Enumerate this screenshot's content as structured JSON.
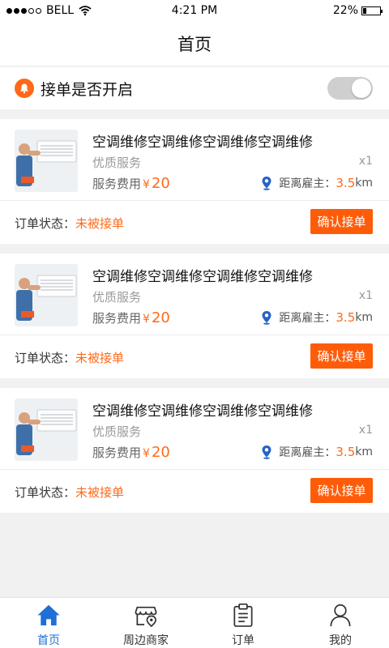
{
  "status_bar": {
    "carrier": "BELL",
    "time": "4:21 PM",
    "battery": "22%",
    "battery_level": 0.22
  },
  "nav": {
    "title": "首页"
  },
  "accept_toggle": {
    "label": "接单是否开启",
    "enabled": false
  },
  "orders": [
    {
      "title": "空调维修空调维修空调维修空调维修",
      "subtitle": "优质服务",
      "quantity": "x1",
      "fee_label": "服务费用",
      "currency": "¥",
      "fee": "20",
      "distance_label": "距离雇主：",
      "distance_value": "3.5",
      "distance_unit": "km",
      "status_label": "订单状态：",
      "status": "未被接单",
      "action": "确认接单"
    },
    {
      "title": "空调维修空调维修空调维修空调维修",
      "subtitle": "优质服务",
      "quantity": "x1",
      "fee_label": "服务费用",
      "currency": "¥",
      "fee": "20",
      "distance_label": "距离雇主：",
      "distance_value": "3.5",
      "distance_unit": "km",
      "status_label": "订单状态：",
      "status": "未被接单",
      "action": "确认接单"
    },
    {
      "title": "空调维修空调维修空调维修空调维修",
      "subtitle": "优质服务",
      "quantity": "x1",
      "fee_label": "服务费用",
      "currency": "¥",
      "fee": "20",
      "distance_label": "距离雇主：",
      "distance_value": "3.5",
      "distance_unit": "km",
      "status_label": "订单状态：",
      "status": "未被接单",
      "action": "确认接单"
    }
  ],
  "tabs": [
    {
      "label": "首页",
      "icon": "home-icon",
      "active": true
    },
    {
      "label": "周边商家",
      "icon": "store-location-icon",
      "active": false
    },
    {
      "label": "订单",
      "icon": "clipboard-icon",
      "active": false
    },
    {
      "label": "我的",
      "icon": "user-icon",
      "active": false
    }
  ],
  "colors": {
    "accent": "#ff5c0a",
    "active_tab": "#1f6fd6",
    "background": "#f1f1f1"
  }
}
